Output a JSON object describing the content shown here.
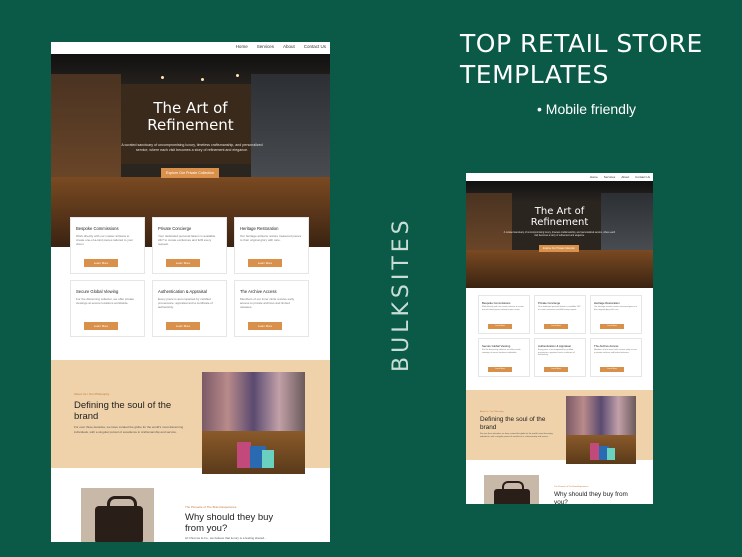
{
  "headline": {
    "line1": "TOP RETAIL STORE",
    "line2": "TEMPLATES"
  },
  "bullet": "• Mobile friendly",
  "brand": "BULKSITES",
  "site": {
    "nav": [
      "Home",
      "Services",
      "About",
      "Contact Us"
    ],
    "hero": {
      "title_line1": "The Art of",
      "title_line2": "Refinement",
      "subtitle": "A curated sanctuary of uncompromising luxury, timeless craftsmanship, and personalized service, where each visit becomes a story of refinement and elegance.",
      "button": "Explore Our Private Collection"
    },
    "cards": [
      {
        "title": "Bespoke Commissions",
        "desc": "Work directly with our master artisans to create one-of-a-kind pieces tailored to your vision.",
        "button": "Learn More"
      },
      {
        "title": "Private Concierge",
        "desc": "Your dedicated personal liaison is available 24/7 to curate exclusives and fulfil every request.",
        "button": "Learn More"
      },
      {
        "title": "Heritage Restoration",
        "desc": "Our heritage artisans restore treasured pieces to their original glory with care.",
        "button": "Learn More"
      },
      {
        "title": "Secure Global Viewing",
        "desc": "For the discerning collector, we offer private viewings at secure locations worldwide.",
        "button": "Learn More"
      },
      {
        "title": "Authentication & Appraisal",
        "desc": "Every piece is accompanied by certified provenance, appraisal and a certificate of authenticity.",
        "button": "Learn More"
      },
      {
        "title": "The Archive Access",
        "desc": "Members of our inner circle receive early access to private archives and limited releases.",
        "button": "Learn More"
      }
    ],
    "soul": {
      "eyebrow": "About Us / Our Philosophy",
      "title": "Defining the soul of the brand",
      "body": "For over three decades, we have curated the globe for the world's most discerning individuals, with a singular pursuit of excellence in craftsmanship and service."
    },
    "why": {
      "eyebrow": "The Pinnacle of The Brand Experience",
      "title": "Why should they buy from you?",
      "body": "At Chronos & Co., we believe that luxury is a feeling shared..."
    }
  },
  "colors": {
    "background": "#0b5a48",
    "accent": "#d9904a",
    "beige": "#efd2aa"
  }
}
